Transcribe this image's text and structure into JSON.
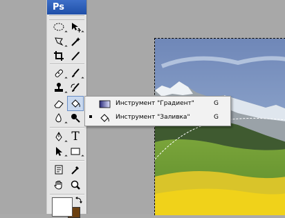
{
  "app": {
    "logo_text": "Ps"
  },
  "toolbox": {
    "tools": [
      {
        "name": "marquee-tool",
        "icon": "ellipse-marquee-icon"
      },
      {
        "name": "move-tool",
        "icon": "move-icon"
      },
      {
        "name": "lasso-tool",
        "icon": "lasso-icon"
      },
      {
        "name": "magic-wand-tool",
        "icon": "magic-wand-icon"
      },
      {
        "name": "crop-tool",
        "icon": "crop-icon"
      },
      {
        "name": "slice-tool",
        "icon": "slice-icon"
      },
      {
        "name": "healing-brush-tool",
        "icon": "bandage-icon"
      },
      {
        "name": "brush-tool",
        "icon": "brush-icon"
      },
      {
        "name": "clone-stamp-tool",
        "icon": "stamp-icon"
      },
      {
        "name": "history-brush-tool",
        "icon": "history-brush-icon"
      },
      {
        "name": "eraser-tool",
        "icon": "eraser-icon"
      },
      {
        "name": "paint-bucket-tool",
        "icon": "paint-bucket-icon"
      },
      {
        "name": "blur-tool",
        "icon": "blur-drop-icon"
      },
      {
        "name": "dodge-tool",
        "icon": "dodge-icon"
      },
      {
        "name": "pen-tool",
        "icon": "pen-icon"
      },
      {
        "name": "type-tool",
        "icon": "type-icon",
        "glyph": "T"
      },
      {
        "name": "path-selection-tool",
        "icon": "arrow-icon"
      },
      {
        "name": "rectangle-tool",
        "icon": "rectangle-icon"
      },
      {
        "name": "notes-tool",
        "icon": "notes-icon"
      },
      {
        "name": "eyedropper-tool",
        "icon": "eyedropper-icon"
      },
      {
        "name": "hand-tool",
        "icon": "hand-icon"
      },
      {
        "name": "zoom-tool",
        "icon": "zoom-icon"
      }
    ],
    "foreground_color": "#ffffff",
    "background_color": "#6b4010"
  },
  "flyout": {
    "items": [
      {
        "label": "Инструмент \"Градиент\"",
        "shortcut": "G",
        "icon": "gradient-icon",
        "selected": false
      },
      {
        "label": "Инструмент \"Заливка\"",
        "shortcut": "G",
        "icon": "paint-bucket-icon",
        "selected": true
      }
    ]
  }
}
